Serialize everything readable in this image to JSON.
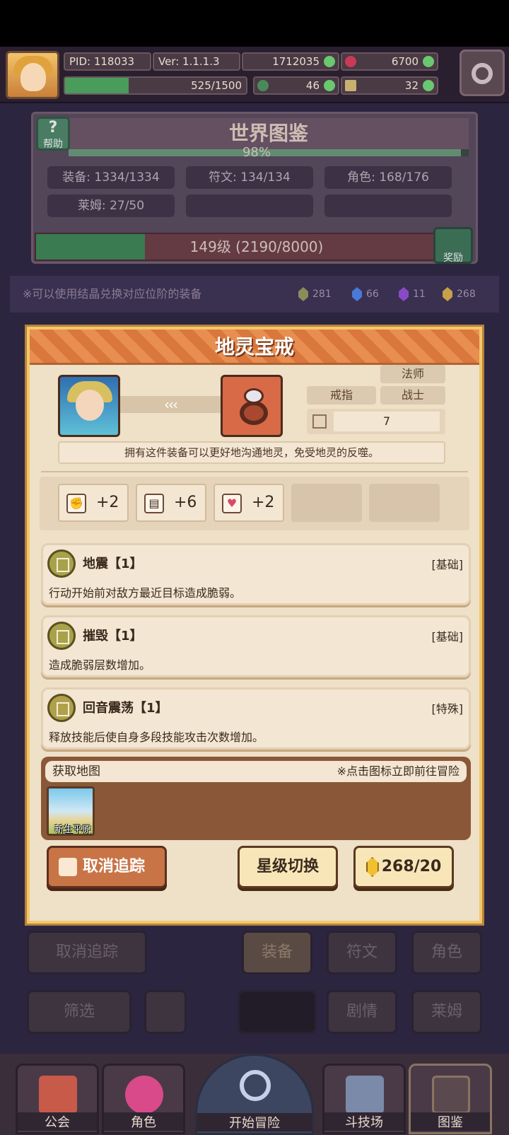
{
  "header": {
    "pid": "PID: 118033",
    "version": "Ver: 1.1.1.3",
    "gold": "1712035",
    "gems": "6700",
    "stamina": "525/1500",
    "stamina_fraction": 0.35,
    "clover": "46",
    "hammer": "32",
    "settings_icon": "gear-icon"
  },
  "codex": {
    "title": "世界图鉴",
    "help_label": "帮助",
    "percent": "98%",
    "percent_value": 0.98,
    "equip": "装备: 1334/1334",
    "rune": "符文: 134/134",
    "role": "角色: 168/176",
    "slime": "莱姆: 27/50",
    "level": "149级 (2190/8000)",
    "level_fraction": 0.274,
    "reward_label": "奖励"
  },
  "crystal_bar": {
    "hint": "※可以使用结晶兑换对应位阶的装备",
    "counts": [
      "281",
      "66",
      "11",
      "268"
    ],
    "colors": [
      "#8a8c5a",
      "#4a7ad8",
      "#8a4ac8",
      "#c8a048"
    ]
  },
  "modal": {
    "title": "地灵宝戒",
    "arrows": "‹‹‹",
    "type": "戒指",
    "class_mage": "法师",
    "class_warrior": "战士",
    "count": "7",
    "description": "拥有这件装备可以更好地沟通地灵，免受地灵的反噬。",
    "attrs": [
      {
        "icon": "fist-icon",
        "glyph": "✊",
        "value": "+2"
      },
      {
        "icon": "book-icon",
        "glyph": "▤",
        "value": "+6"
      },
      {
        "icon": "heart-icon",
        "glyph": "♥",
        "value": "+2"
      }
    ],
    "skills": [
      {
        "name": "地震【1】",
        "kind": "[基础]",
        "text": "行动开始前对敌方最近目标造成脆弱。"
      },
      {
        "name": "摧毁【1】",
        "kind": "[基础]",
        "text": "造成脆弱层数增加。"
      },
      {
        "name": "回音震荡【1】",
        "kind": "[特殊]",
        "text": "释放技能后使自身多段技能攻击次数增加。"
      }
    ],
    "map_title": "获取地图",
    "map_tip": "※点击图标立即前往冒险",
    "map_name": "新生平原",
    "untrack_label": "取消追踪",
    "star_switch_label": "星级切换",
    "cost_label": "268/20"
  },
  "background_controls": {
    "untrack": "取消追踪",
    "equip": "装备",
    "rune": "符文",
    "role": "角色",
    "filter": "筛选",
    "story": "剧情",
    "slime": "莱姆"
  },
  "nav": {
    "guild": "公会",
    "role": "角色",
    "start": "开始冒险",
    "arena": "斗技场",
    "codex": "图鉴"
  }
}
